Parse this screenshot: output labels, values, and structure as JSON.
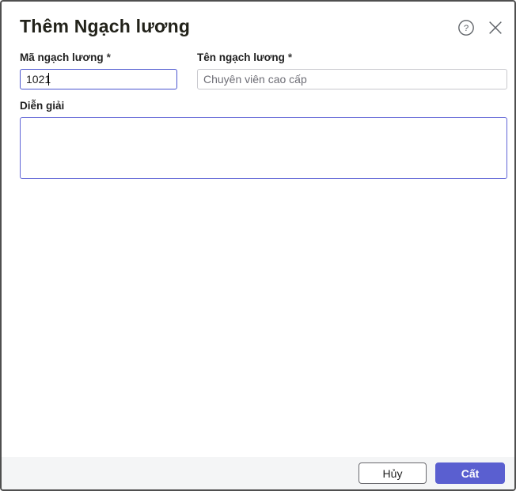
{
  "dialog": {
    "title": "Thêm Ngạch lương"
  },
  "fields": {
    "code": {
      "label": "Mã ngạch lương",
      "required_mark": "*",
      "value": "1021",
      "state": "focused"
    },
    "name": {
      "label": "Tên ngạch lương",
      "required_mark": "*",
      "value": "",
      "placeholder": "Chuyên viên cao cấp"
    },
    "description": {
      "label": "Diễn giải",
      "value": ""
    }
  },
  "header_icons": {
    "help": "circle-question-icon",
    "close": "close-icon"
  },
  "footer": {
    "cancel_label": "Hủy",
    "save_label": "Cất"
  },
  "colors": {
    "accent": "#5a5fd0",
    "focus_border": "#4a55cf",
    "textarea_border": "#5f64d6",
    "footer_bg": "#f4f5f6",
    "input_border": "#c8c8cd",
    "icon_gray": "#5f6368",
    "dialog_border": "#4f4f4f"
  }
}
